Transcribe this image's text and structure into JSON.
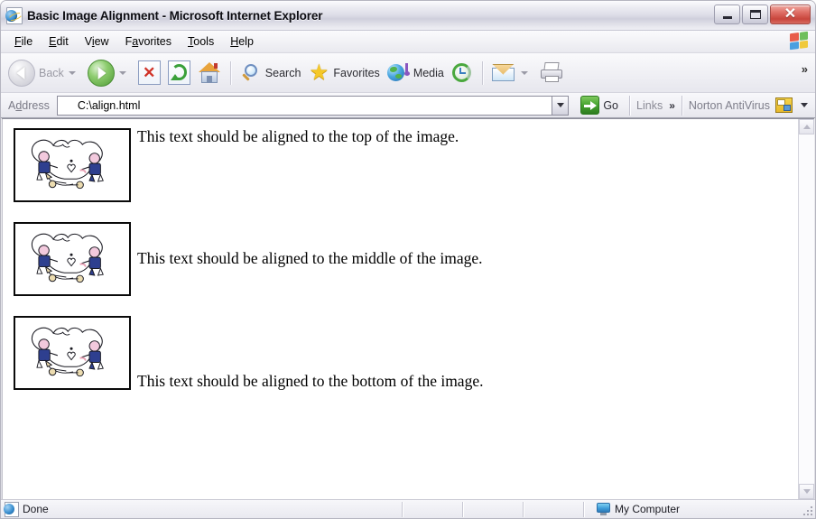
{
  "window": {
    "title": "Basic Image Alignment - Microsoft Internet Explorer",
    "title_icon": "ie-document-icon",
    "buttons": {
      "minimize": "minimize-button",
      "maximize": "maximize-button",
      "close_glyph": "✕"
    }
  },
  "menubar": {
    "items": [
      {
        "label": "File",
        "accel": "F",
        "rest": "ile"
      },
      {
        "label": "Edit",
        "accel": "E",
        "rest": "dit"
      },
      {
        "label": "View",
        "pre": "V",
        "accel": "i",
        "rest": "ew"
      },
      {
        "label": "Favorites",
        "pre": "F",
        "accel": "a",
        "rest": "vorites"
      },
      {
        "label": "Tools",
        "accel": "T",
        "rest": "ools"
      },
      {
        "label": "Help",
        "accel": "H",
        "rest": "elp"
      }
    ],
    "logo": "windows-flag-logo"
  },
  "toolbar": {
    "back_label": "Back",
    "back_enabled": false,
    "forward_label": "",
    "stop_label": "",
    "refresh_label": "",
    "home_label": "",
    "search_label": "Search",
    "favorites_label": "Favorites",
    "media_label": "Media",
    "history_label": "",
    "mail_label": "",
    "print_label": "",
    "overflow_chevron": "»",
    "star_glyph": "★",
    "stop_glyph": "✕"
  },
  "addressbar": {
    "label": "Address",
    "label_pre": "A",
    "label_accel": "d",
    "label_rest": "dress",
    "value": "C:\\align.html",
    "placeholder": "",
    "go_label": "Go",
    "links_label": "Links",
    "links_chevron": "»",
    "norton_label": "Norton AntiVirus"
  },
  "page": {
    "rows": [
      {
        "align": "top",
        "text": "This text should be aligned to the top of the image.",
        "image_alt": "two-cherubs-clipart"
      },
      {
        "align": "middle",
        "text": "This text should be aligned to the middle of the image.",
        "image_alt": "two-cherubs-clipart"
      },
      {
        "align": "bottom",
        "text": "This text should be aligned to the bottom of the image.",
        "image_alt": "two-cherubs-clipart"
      }
    ]
  },
  "statusbar": {
    "status": "Done",
    "zone": "My Computer"
  },
  "colors": {
    "title_text": "#0c0c12",
    "close_button": "#c8453c",
    "go_green": "#45a32f",
    "page_bg": "#ffffff",
    "chrome_bg": "#eeeef4",
    "clipart_blue": "#2e3f8f",
    "clipart_pink": "#f0c4d8",
    "clipart_cream": "#ecdcb0"
  }
}
